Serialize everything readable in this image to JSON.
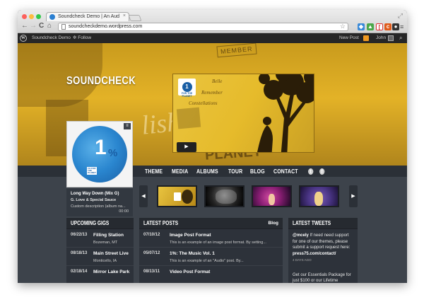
{
  "browser": {
    "tab_title": "Soundcheck Demo | An Aud",
    "tab_close": "×",
    "url": "soundcheckdemo.wordpress.com",
    "back": "←",
    "forward": "→",
    "reload": "C",
    "home": "⌂",
    "star": "☆",
    "menu": "≡"
  },
  "adminbar": {
    "wp_logo": "W",
    "site": "Soundcheck Demo",
    "follow": "✲ Follow",
    "new_post": "New Post",
    "user": "John",
    "search": "⌕"
  },
  "hero": {
    "site_title": "SOUNDCHECK",
    "bg_script": "lishire",
    "bg_word1": "MEMBER",
    "bg_word2": "PLANET"
  },
  "video": {
    "badge_num": "1",
    "badge_text": "FOR THE PLANET",
    "script_lines": [
      "Belle",
      "Remember",
      "Constellations"
    ],
    "play": "▶"
  },
  "album": {
    "number": "1",
    "percent": "%",
    "menu": "≡",
    "cover_text": "1% FOR THE PLANET"
  },
  "track": {
    "song": "Long Way Down (Mix G)",
    "artist": "G. Love & Special Sauce",
    "description": "Custom description (album na...",
    "time": "00:00"
  },
  "nav": {
    "items": [
      "THEME",
      "MEDIA",
      "ALBUMS",
      "TOUR",
      "BLOG",
      "CONTACT"
    ],
    "twitter": "t",
    "facebook": "f"
  },
  "carousel": {
    "prev": "◀",
    "next": "▶"
  },
  "gigs": {
    "heading": "UPCOMING GIGS",
    "rows": [
      {
        "date": "06/22/13",
        "venue": "Filling Station",
        "location": "Bozeman, MT"
      },
      {
        "date": "08/18/13",
        "venue": "Main Street Live",
        "location": "Monticello, IA"
      },
      {
        "date": "02/18/14",
        "venue": "Mirror Lake Park",
        "location": ""
      }
    ]
  },
  "posts": {
    "heading": "LATEST POSTS",
    "blog_link": "Blog",
    "rows": [
      {
        "date": "07/10/12",
        "title": "Image Post Format",
        "excerpt": "This is an example of an image post format. By setting..."
      },
      {
        "date": "05/07/12",
        "title": "1%: The Music Vol. 1",
        "excerpt": "This is an example of an \"Audio\" post. By..."
      },
      {
        "date": "08/13/11",
        "title": "Video Post Format",
        "excerpt": ""
      }
    ]
  },
  "tweets": {
    "heading": "LATEST TWEETS",
    "handle": "@mcely",
    "body": "If need need support for one of our themes, please submit a support request here:",
    "link": "press75.com/contact/",
    "age": "4 DAYS AGO",
    "body2": "Get our Essentials Package for just $100 or our Lifetime"
  },
  "colors": {
    "hero": "#e3b227",
    "panel": "#2d323a",
    "chrome_red": "#fc605c",
    "chrome_yellow": "#fdbc40",
    "chrome_green": "#34c84a"
  }
}
